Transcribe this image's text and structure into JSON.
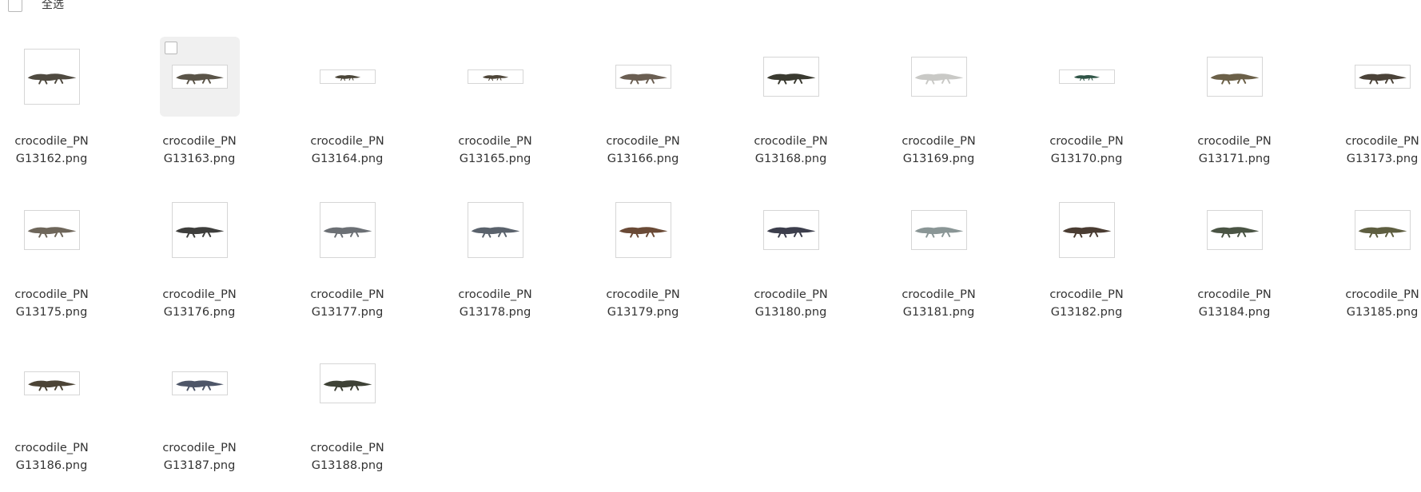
{
  "toolbar": {
    "select_all_label": "全选"
  },
  "files": [
    {
      "name_line1": "crocodile_PN",
      "name_line2": "G13162.png",
      "thumb": "tall",
      "icon": "crocodile-icon",
      "tone": "#4f4a40"
    },
    {
      "name_line1": "crocodile_PN",
      "name_line2": "G13163.png",
      "thumb": "wide",
      "icon": "crocodile-icon",
      "tone": "#5a5448",
      "hover": true
    },
    {
      "name_line1": "crocodile_PN",
      "name_line2": "G13164.png",
      "thumb": "slim",
      "icon": "crocodile-icon",
      "tone": "#4a4538"
    },
    {
      "name_line1": "crocodile_PN",
      "name_line2": "G13165.png",
      "thumb": "slim",
      "icon": "crocodile-icon",
      "tone": "#4d4538"
    },
    {
      "name_line1": "crocodile_PN",
      "name_line2": "G13166.png",
      "thumb": "wide",
      "icon": "crocodile-icon",
      "tone": "#6a5e52"
    },
    {
      "name_line1": "crocodile_PN",
      "name_line2": "G13168.png",
      "thumb": "mid",
      "icon": "crocodile-icon",
      "tone": "#3a3a30"
    },
    {
      "name_line1": "crocodile_PN",
      "name_line2": "G13169.png",
      "thumb": "mid",
      "icon": "crocodile-icon",
      "tone": "#c9c9c6"
    },
    {
      "name_line1": "crocodile_PN",
      "name_line2": "G13170.png",
      "thumb": "slim",
      "icon": "crocodile-icon",
      "tone": "#2f5446"
    },
    {
      "name_line1": "crocodile_PN",
      "name_line2": "G13171.png",
      "thumb": "mid",
      "icon": "crocodile-icon",
      "tone": "#6b6048"
    },
    {
      "name_line1": "crocodile_PN",
      "name_line2": "G13173.png",
      "thumb": "wide",
      "icon": "crocodile-icon",
      "tone": "#4a4238"
    },
    {
      "name_line1": "crocodile_PN",
      "name_line2": "G13175.png",
      "thumb": "mid",
      "icon": "crocodile-icon",
      "tone": "#6e665a"
    },
    {
      "name_line1": "crocodile_PN",
      "name_line2": "G13176.png",
      "thumb": "tall",
      "icon": "crocodile-icon",
      "tone": "#3e3e3c"
    },
    {
      "name_line1": "crocodile_PN",
      "name_line2": "G13177.png",
      "thumb": "tall",
      "icon": "crocodile-icon",
      "tone": "#6c7075"
    },
    {
      "name_line1": "crocodile_PN",
      "name_line2": "G13178.png",
      "thumb": "tall",
      "icon": "crocodile-icon",
      "tone": "#5a626c"
    },
    {
      "name_line1": "crocodile_PN",
      "name_line2": "G13179.png",
      "thumb": "tall",
      "icon": "crocodile-icon",
      "tone": "#6a4a36"
    },
    {
      "name_line1": "crocodile_PN",
      "name_line2": "G13180.png",
      "thumb": "mid",
      "icon": "crocodile-icon",
      "tone": "#3c3e4c"
    },
    {
      "name_line1": "crocodile_PN",
      "name_line2": "G13181.png",
      "thumb": "mid",
      "icon": "crocodile-icon",
      "tone": "#8a9696"
    },
    {
      "name_line1": "crocodile_PN",
      "name_line2": "G13182.png",
      "thumb": "tall",
      "icon": "crocodile-icon",
      "tone": "#4a3c32"
    },
    {
      "name_line1": "crocodile_PN",
      "name_line2": "G13184.png",
      "thumb": "mid",
      "icon": "crocodile-icon",
      "tone": "#4a5444"
    },
    {
      "name_line1": "crocodile_PN",
      "name_line2": "G13185.png",
      "thumb": "mid",
      "icon": "crocodile-icon",
      "tone": "#5e5e40"
    },
    {
      "name_line1": "crocodile_PN",
      "name_line2": "G13186.png",
      "thumb": "wide",
      "icon": "crocodile-icon",
      "tone": "#4c4436"
    },
    {
      "name_line1": "crocodile_PN",
      "name_line2": "G13187.png",
      "thumb": "wide",
      "icon": "crocodile-icon",
      "tone": "#4e5668"
    },
    {
      "name_line1": "crocodile_PN",
      "name_line2": "G13188.png",
      "thumb": "mid",
      "icon": "crocodile-icon",
      "tone": "#3e4236"
    }
  ]
}
